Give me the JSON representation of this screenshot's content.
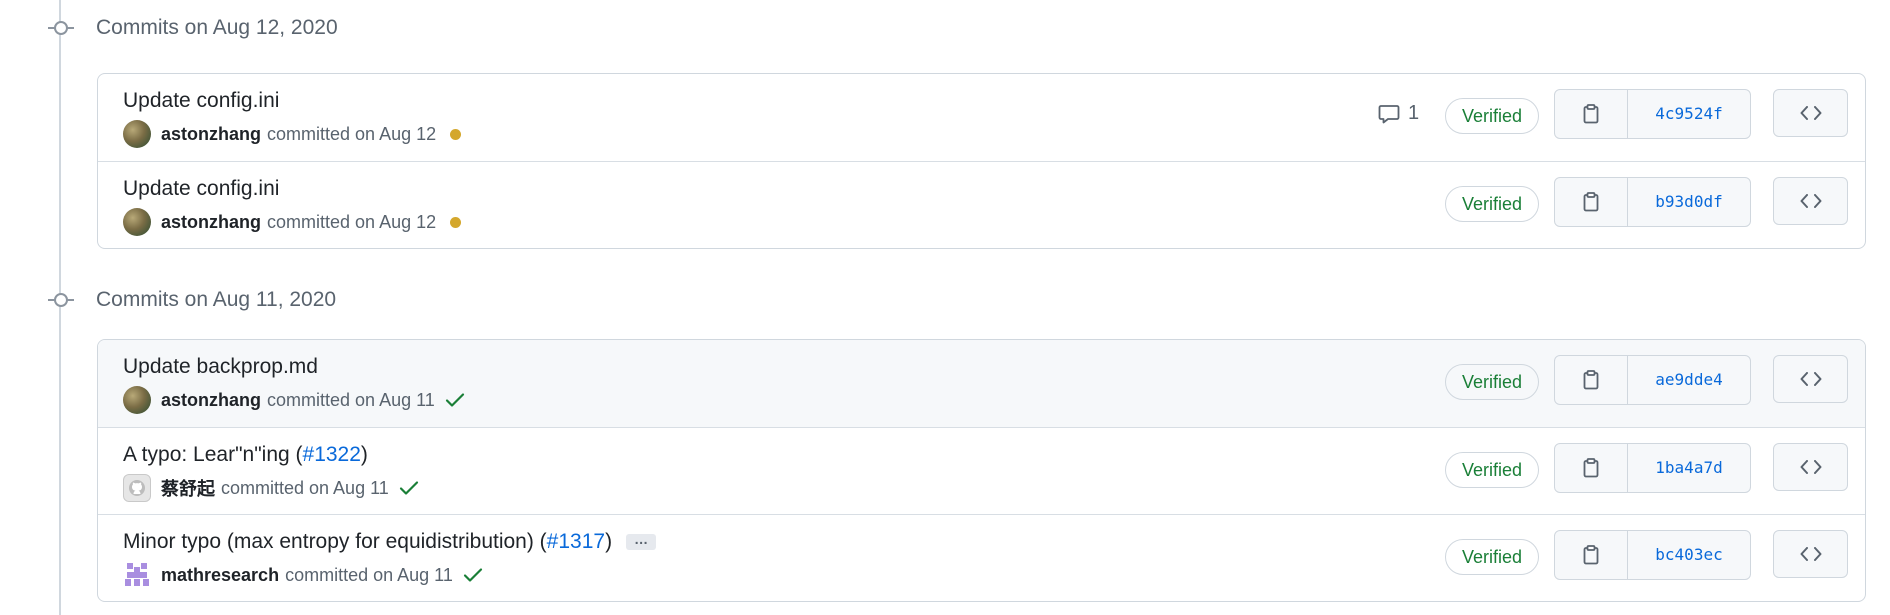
{
  "groups": [
    {
      "title": "Commits on Aug 12, 2020",
      "commits": [
        {
          "message": "Update config.ini",
          "author": "astonzhang",
          "committed": "committed on Aug 12",
          "status": "pending",
          "comments": "1",
          "verified": "Verified",
          "sha": "4c9524f"
        },
        {
          "message": "Update config.ini",
          "author": "astonzhang",
          "committed": "committed on Aug 12",
          "status": "pending",
          "verified": "Verified",
          "sha": "b93d0df"
        }
      ]
    },
    {
      "title": "Commits on Aug 11, 2020",
      "commits": [
        {
          "message": "Update backprop.md",
          "author": "astonzhang",
          "committed": "committed on Aug 11",
          "status": "success",
          "verified": "Verified",
          "sha": "ae9dde4"
        },
        {
          "message": "A typo: Lear\"n\"ing (",
          "pr": "#1322",
          "suffix": ")",
          "author": "蔡舒起",
          "committed": "committed on Aug 11",
          "status": "success",
          "verified": "Verified",
          "sha": "1ba4a7d"
        },
        {
          "message": "Minor typo (max entropy for equidistribution) (",
          "pr": "#1317",
          "suffix": ")",
          "expand": "…",
          "author": "mathresearch",
          "committed": "committed on Aug 11",
          "status": "success",
          "verified": "Verified",
          "sha": "bc403ec"
        }
      ]
    }
  ],
  "colors": {
    "verified": "#1a7f37",
    "link": "#0969da",
    "pending": "#d4a72c",
    "muted": "#59636e",
    "border": "#d0d7de"
  },
  "icons": {
    "timeline": "git-commit-icon",
    "comment": "comment-icon",
    "copy": "copy-icon",
    "browse": "code-icon",
    "pending": "dot-fill-icon",
    "success": "check-icon"
  }
}
